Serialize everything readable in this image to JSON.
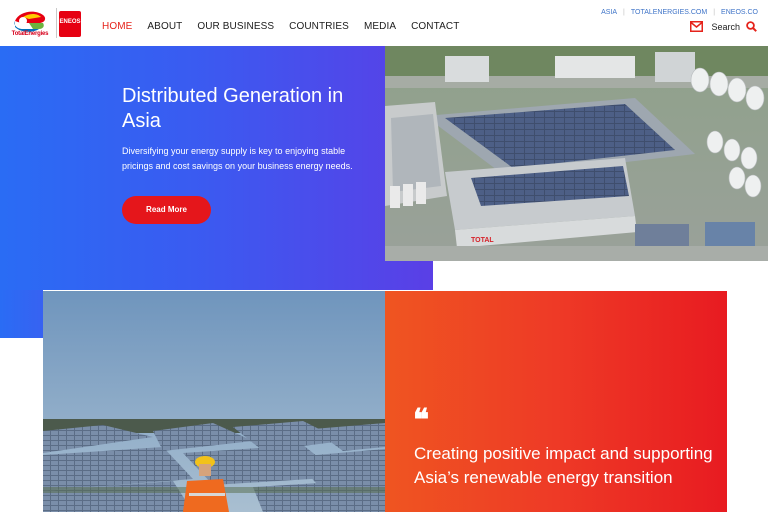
{
  "brand": {
    "total_name": "TotalEnergies",
    "eneos_name": "ENEOS"
  },
  "nav": {
    "items": [
      {
        "label": "HOME",
        "active": true
      },
      {
        "label": "ABOUT",
        "active": false
      },
      {
        "label": "OUR BUSINESS",
        "active": false
      },
      {
        "label": "COUNTRIES",
        "active": false
      },
      {
        "label": "MEDIA",
        "active": false
      },
      {
        "label": "CONTACT",
        "active": false
      }
    ]
  },
  "toplinks": [
    "ASIA",
    "TOTALENERGIES.COM",
    "ENEOS.CO"
  ],
  "utility": {
    "mail_icon": "mail-icon",
    "search_label": "Search",
    "search_icon": "search-icon"
  },
  "hero": {
    "title": "Distributed Generation in Asia",
    "description": "Diversifying your energy supply is key to enjoying stable pricings and cost savings on your business energy needs.",
    "button_label": "Read More"
  },
  "quote": {
    "mark": "❝",
    "text": "Creating positive impact and supporting Asia’s renewable energy transition"
  },
  "colors": {
    "accent_red": "#e5231b",
    "hero_blue": "#2a6cf4",
    "link_blue": "#3f74c8"
  }
}
